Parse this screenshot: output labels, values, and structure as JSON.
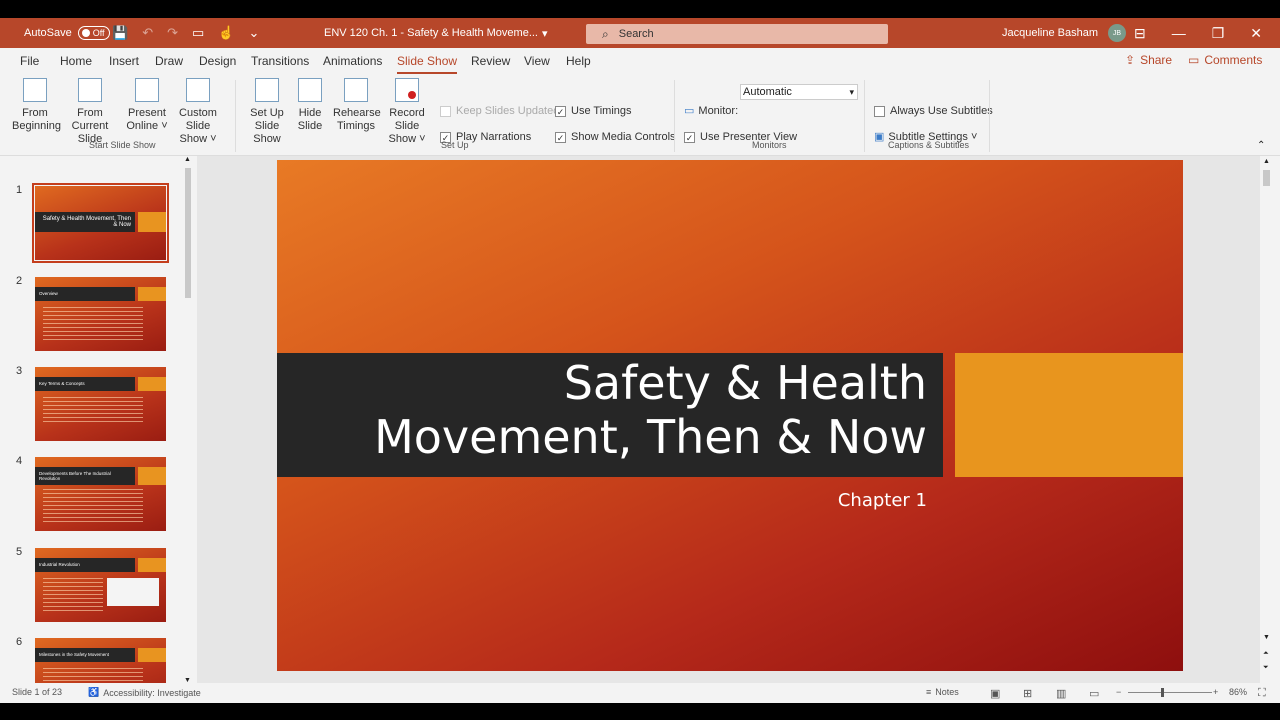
{
  "titlebar": {
    "autosave_label": "AutoSave",
    "autosave_state": "Off",
    "document_title": "ENV 120 Ch. 1 - Safety & Health Moveme...",
    "search_placeholder": "Search",
    "user_name": "Jacqueline Basham",
    "user_initials": "JB"
  },
  "menu": {
    "items": [
      "File",
      "Home",
      "Insert",
      "Draw",
      "Design",
      "Transitions",
      "Animations",
      "Slide Show",
      "Review",
      "View",
      "Help"
    ],
    "active": "Slide Show",
    "share_label": "Share",
    "comments_label": "Comments"
  },
  "ribbon": {
    "from_beginning": [
      "From",
      "Beginning"
    ],
    "from_current": [
      "From",
      "Current Slide"
    ],
    "present_online": [
      "Present",
      "Online ˅"
    ],
    "custom_slide_show": [
      "Custom Slide",
      "Show ˅"
    ],
    "group_start": "Start Slide Show",
    "set_up": [
      "Set Up",
      "Slide Show"
    ],
    "hide_slide": [
      "Hide",
      "Slide"
    ],
    "rehearse": [
      "Rehearse",
      "Timings"
    ],
    "record": [
      "Record Slide",
      "Show ˅"
    ],
    "keep_slides_updated": "Keep Slides Updated",
    "play_narrations": "Play Narrations",
    "use_timings": "Use Timings",
    "show_media_controls": "Show Media Controls",
    "group_setup": "Set Up",
    "monitor_label": "Monitor:",
    "monitor_value": "Automatic",
    "use_presenter_view": "Use Presenter View",
    "group_monitors": "Monitors",
    "always_use_subtitles": "Always Use Subtitles",
    "subtitle_settings": "Subtitle Settings ˅",
    "group_captions": "Captions & Subtitles"
  },
  "thumbnails": [
    {
      "num": "1",
      "title": "Safety & Health Movement, Then & Now"
    },
    {
      "num": "2",
      "title": "Overview"
    },
    {
      "num": "3",
      "title": "Key Terms & Concepts"
    },
    {
      "num": "4",
      "title": "Developments Before The Industrial Revolution"
    },
    {
      "num": "5",
      "title": "Industrial Revolution"
    },
    {
      "num": "6",
      "title": "Milestones in the Safety Movement"
    }
  ],
  "slide": {
    "title_line1": "Safety & Health",
    "title_line2": "Movement, Then & Now",
    "subtitle": "Chapter 1"
  },
  "status": {
    "slide_counter": "Slide 1 of 23",
    "accessibility": "Accessibility: Investigate",
    "notes": "Notes",
    "zoom": "86%"
  },
  "colors": {
    "accent": "#b7472a",
    "slide_orange": "#e8951e",
    "slide_dark_band": "#262626"
  }
}
